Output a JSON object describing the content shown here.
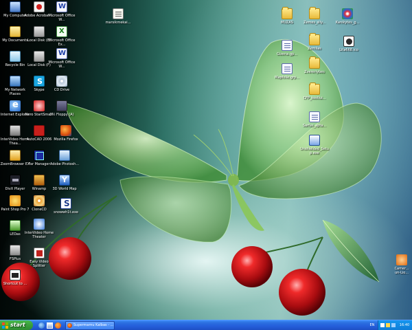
{
  "desktop": {
    "icons_left": [
      {
        "label": "My Computer",
        "icon": "computer-icon",
        "glyph": "g-computer"
      },
      {
        "label": "Adobe Acrobat ...",
        "icon": "pdf-icon",
        "glyph": "g-pdf"
      },
      {
        "label": "Microsoft Office W...",
        "icon": "word-icon",
        "glyph": "g-word"
      },
      {
        "label": "My Documents",
        "icon": "documents-icon",
        "glyph": "g-docs"
      },
      {
        "label": "Local Disk (E)",
        "icon": "disk-icon",
        "glyph": "g-disk"
      },
      {
        "label": "Microsoft Office Ex...",
        "icon": "excel-icon",
        "glyph": "g-excel"
      },
      {
        "label": "Recycle Bin",
        "icon": "recycle-bin-icon",
        "glyph": "g-recycle"
      },
      {
        "label": "Local Disk (F)",
        "icon": "disk-icon",
        "glyph": "g-disk"
      },
      {
        "label": "Microsoft Office W...",
        "icon": "word-icon",
        "glyph": "g-word"
      },
      {
        "label": "My Network Places",
        "icon": "network-icon",
        "glyph": "g-network"
      },
      {
        "label": "Skype",
        "icon": "skype-icon",
        "glyph": "g-skype"
      },
      {
        "label": "CD Drive",
        "icon": "cd-drive-icon",
        "glyph": "g-cd"
      },
      {
        "label": "Internet Explorer",
        "icon": "internet-explorer-icon",
        "glyph": "g-ie"
      },
      {
        "label": "Nero StartSmart",
        "icon": "nero-icon",
        "glyph": "g-nero"
      },
      {
        "label": "3½ Floppy (A)",
        "icon": "floppy-icon",
        "glyph": "g-floppy"
      },
      {
        "label": "InterVideo Home Thea...",
        "icon": "video-icon",
        "glyph": "g-video"
      },
      {
        "label": "AutoCAD 2006",
        "icon": "autocad-icon",
        "glyph": "g-autocad"
      },
      {
        "label": "Mozilla Firefox",
        "icon": "firefox-icon",
        "glyph": "g-firefox"
      },
      {
        "label": "ZoomBrowser EX",
        "icon": "zoombrowser-icon",
        "glyph": "g-zoom"
      },
      {
        "label": "Far Manager",
        "icon": "far-manager-icon",
        "glyph": "g-farmgr"
      },
      {
        "label": "Adobe Photosh...",
        "icon": "photoshop-icon",
        "glyph": "g-photoshop"
      },
      {
        "label": "DivX Player",
        "icon": "divx-icon",
        "glyph": "g-divx"
      },
      {
        "label": "Winamp",
        "icon": "winamp-icon",
        "glyph": "g-winamp"
      },
      {
        "label": "3D World Map",
        "icon": "world-map-icon",
        "glyph": "g-3dworld"
      },
      {
        "label": "Paint Shop Pro 7",
        "icon": "paint-shop-icon",
        "glyph": "g-paintshop"
      },
      {
        "label": "CloneCD",
        "icon": "clonecd-icon",
        "glyph": "g-clonecd"
      },
      {
        "label": "snowwh1t.exe",
        "icon": "exe-icon",
        "glyph": "g-snowwhite"
      },
      {
        "label": "LEDas",
        "icon": "ledas-icon",
        "glyph": "g-ledas"
      },
      {
        "label": "InterVideo Home Theater",
        "icon": "intervideo-icon",
        "glyph": "g-intervideo"
      },
      {
        "label": "FSPlus",
        "icon": "fsplus-icon",
        "glyph": "g-fsplus"
      },
      {
        "label": "Easy Video Splitter",
        "icon": "video-splitter-icon",
        "glyph": "g-easyvideo"
      },
      {
        "label": "Shortcut to ...",
        "icon": "shortcut-icon",
        "glyph": "g-shortcut"
      }
    ],
    "icons_right": [
      {
        "label": "marsikmekai...",
        "icon": "text-file-icon",
        "glyph": "g-textfile"
      },
      {
        "label": "MUZAS",
        "icon": "folder-icon",
        "glyph": "g-folder"
      },
      {
        "label": "Zemes_sily...",
        "icon": "folder-icon",
        "glyph": "g-folder"
      },
      {
        "label": "Kanikytes_g...",
        "icon": "winbin-icon",
        "glyph": "g-winbin"
      },
      {
        "label": "Gizena.gp...",
        "icon": "document-icon",
        "glyph": "g-doc"
      },
      {
        "label": "Zemlias",
        "icon": "folder-icon",
        "glyph": "g-folder"
      },
      {
        "label": "Lita668.ico",
        "icon": "ico-file-icon",
        "glyph": "g-ico"
      },
      {
        "label": "Mapfolie.grp...",
        "icon": "document-icon",
        "glyph": "g-doc"
      },
      {
        "label": "Zvereriybes",
        "icon": "folder-icon",
        "glyph": "g-folder"
      },
      {
        "label": "CFP_kostiui...",
        "icon": "folder-icon",
        "glyph": "g-folder"
      },
      {
        "label": "Sarfas_apta...",
        "icon": "document-icon",
        "glyph": "g-doc"
      },
      {
        "label": "Unshielded_Setup.exe",
        "icon": "setup-icon",
        "glyph": "g-setup"
      },
      {
        "label": "Camer... un-Lio...",
        "icon": "app-icon",
        "glyph": "g-half"
      }
    ]
  },
  "taskbar": {
    "start_label": "start",
    "task_window_label": "Supermamu Kalbas - ...",
    "language": "EN",
    "clock": "16:40"
  }
}
